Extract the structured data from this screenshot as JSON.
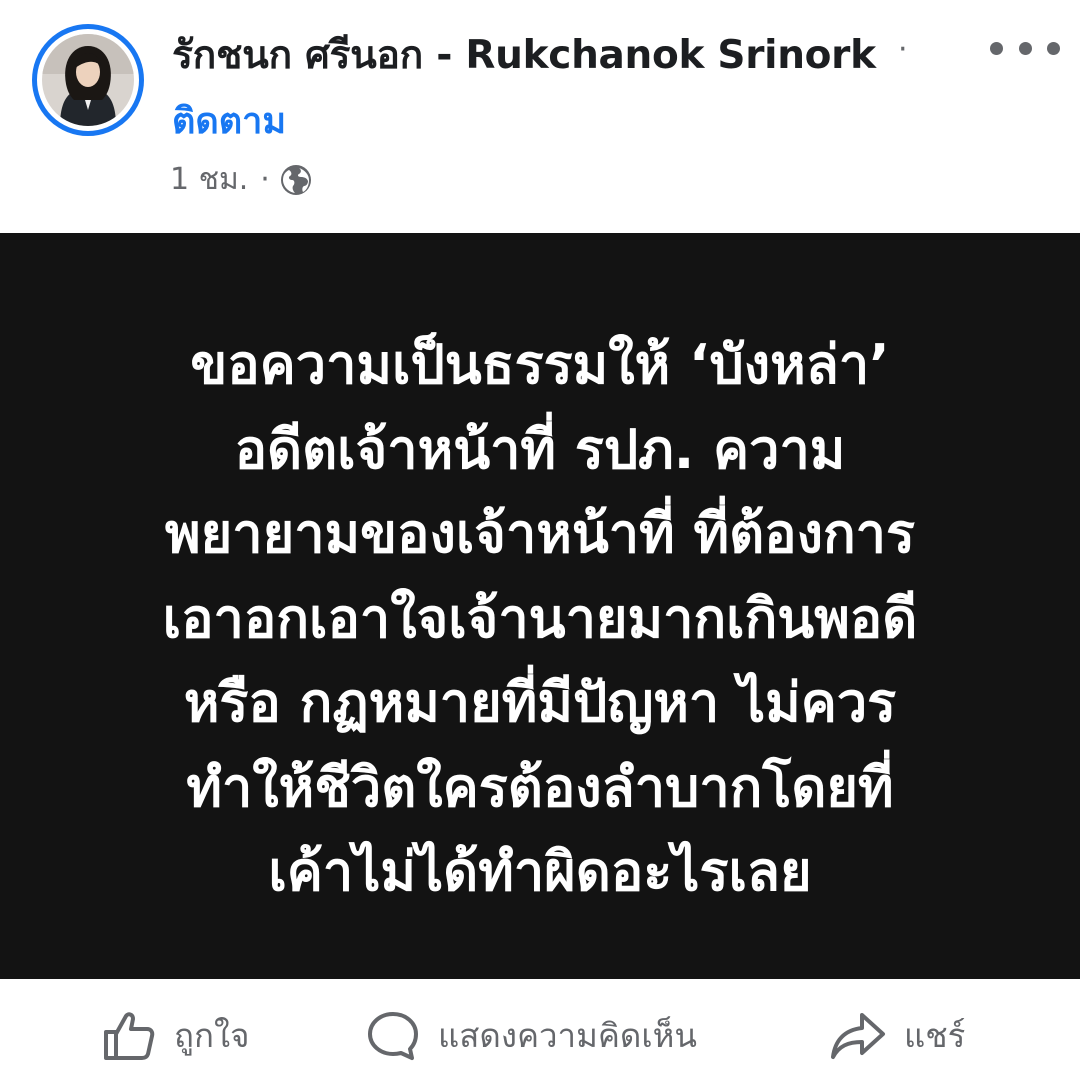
{
  "post": {
    "author_name": "รักชนก ศรีนอก - Rukchanok Srinork",
    "follow_label": "ติดตาม",
    "timestamp": "1 ชม.",
    "separator": "·",
    "audience_icon": "globe-icon",
    "more_icon": "more-options-icon"
  },
  "image_text": {
    "lines": [
      "ขอความเป็นธรรมให้ ‘บังหล่า’",
      "อดีตเจ้าหน้าที่ รปภ. ความ",
      "พยายามของเจ้าหน้าที่ ที่ต้องการ",
      "เอาอกเอาใจเจ้านายมากเกินพอดี",
      "หรือ กฏหมายที่มีปัญหา ไม่ควร",
      "ทำให้ชีวิตใครต้องลำบากโดยที่",
      "เค้าไม่ได้ทำผิดอะไรเลย"
    ]
  },
  "actions": {
    "like_label": "ถูกใจ",
    "comment_label": "แสดงความคิดเห็น",
    "share_label": "แชร์"
  },
  "colors": {
    "accent": "#1877f2",
    "secondary_text": "#65676b",
    "image_background": "#131313"
  }
}
